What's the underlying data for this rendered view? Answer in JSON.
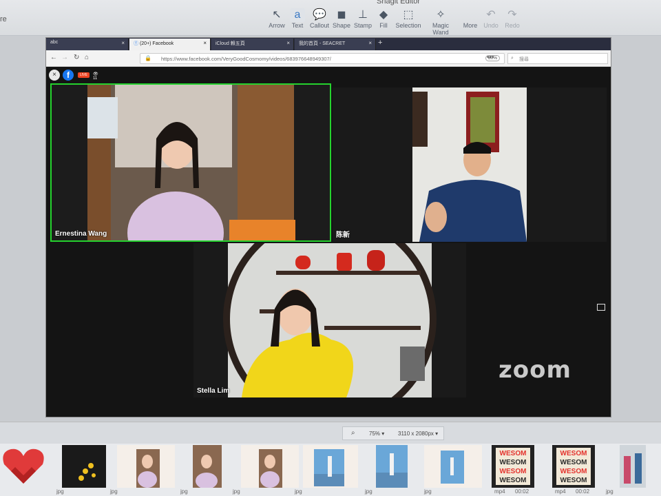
{
  "editor": {
    "title": "Snagit Editor",
    "left_text": "re",
    "tools": [
      {
        "label": "Arrow",
        "icon": "arrow-icon"
      },
      {
        "label": "Text",
        "icon": "text-icon"
      },
      {
        "label": "Callout",
        "icon": "callout-icon"
      },
      {
        "label": "Shape",
        "icon": "shape-icon"
      },
      {
        "label": "Stamp",
        "icon": "stamp-icon"
      },
      {
        "label": "Fill",
        "icon": "fill-icon"
      },
      {
        "label": "Selection",
        "icon": "selection-icon"
      },
      {
        "label": "Magic Wand",
        "icon": "magic-wand-icon"
      },
      {
        "label": "More",
        "icon": "more-icon"
      },
      {
        "label": "Undo",
        "icon": "undo-icon"
      },
      {
        "label": "Redo",
        "icon": "redo-icon"
      }
    ]
  },
  "browser": {
    "tabs": [
      "abc",
      "(20+) Facebook",
      "iCloud 賴五頁",
      "我的首頁 - SEACRET"
    ],
    "url": "https://www.facebook.com/VeryGoodCosmomy/videos/683976648949307/",
    "zoom": "80%",
    "search_placeholder": "搜尋",
    "live_label": "LIVE",
    "viewers": "11"
  },
  "zoom_call": {
    "participants": [
      {
        "name": "Ernestina Wang",
        "active_speaker": true
      },
      {
        "name": "陈新",
        "active_speaker": false
      },
      {
        "name": "Stella Lim",
        "active_speaker": false
      }
    ],
    "logo": "zoom"
  },
  "status": {
    "zoom_level": "75%",
    "dimensions": "3110 x 2080px"
  },
  "tray": {
    "items": [
      {
        "ext": ""
      },
      {
        "ext": "jpg"
      },
      {
        "ext": "jpg"
      },
      {
        "ext": "jpg"
      },
      {
        "ext": "jpg"
      },
      {
        "ext": "jpg"
      },
      {
        "ext": "jpg"
      },
      {
        "ext": "jpg"
      },
      {
        "ext": "mp4",
        "duration": "00:02"
      },
      {
        "ext": "mp4",
        "duration": "00:02"
      },
      {
        "ext": "jpg"
      }
    ],
    "thumb_text": "WESOM"
  }
}
